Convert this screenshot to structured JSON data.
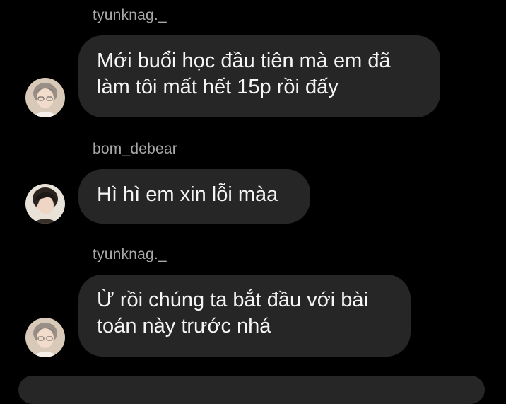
{
  "messages": [
    {
      "sender": "tyunknag._",
      "lines": [
        "Mới buổi học đầu tiên mà em đã",
        "làm tôi mất hết 15p rồi đấy"
      ]
    },
    {
      "sender": "bom_debear",
      "lines": [
        "Hì hì em xin lỗi màa"
      ]
    },
    {
      "sender": "tyunknag._",
      "lines": [
        "Ừ rồi chúng ta bắt đầu với bài",
        "toán này trước nhá"
      ]
    }
  ],
  "colors": {
    "background": "#000000",
    "bubble": "#262626",
    "sender_text": "#a8a8a8",
    "message_text": "#f5f5f5"
  },
  "icons": {
    "avatar_tyunknag": "avatar-icon",
    "avatar_bom_debear": "avatar-icon"
  }
}
